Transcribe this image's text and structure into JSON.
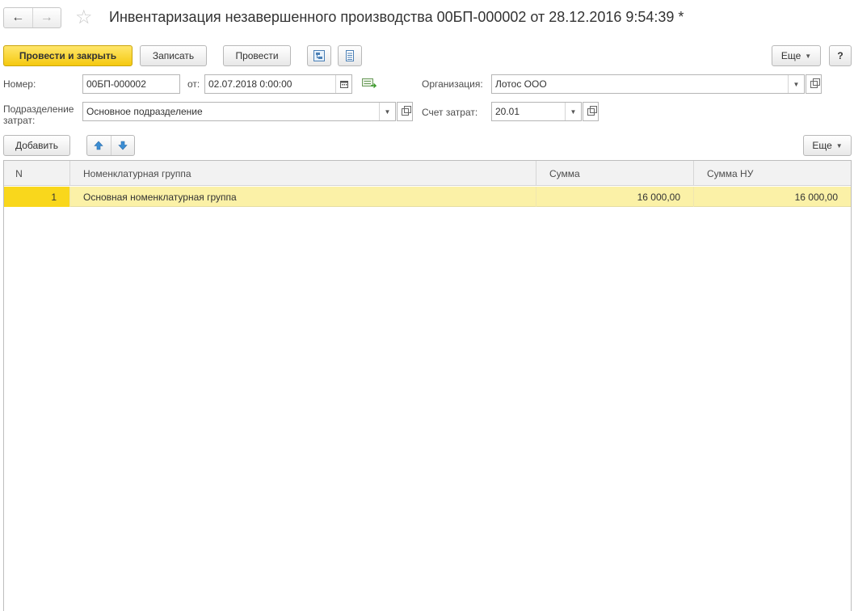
{
  "title": "Инвентаризация незавершенного производства 00БП-000002 от 28.12.2016 9:54:39 *",
  "nav": {
    "back_icon": "arrow-left",
    "forward_icon": "arrow-right",
    "favorite_icon": "star-outline"
  },
  "toolbar": {
    "post_and_close": "Провести и закрыть",
    "save": "Записать",
    "post": "Провести",
    "more": "Еще",
    "help": "?"
  },
  "form": {
    "number_label": "Номер:",
    "number_value": "00БП-000002",
    "date_label": "от:",
    "date_value": "02.07.2018  0:00:00",
    "org_label": "Организация:",
    "org_value": "Лотос ООО",
    "dept_label_1": "Подразделение",
    "dept_label_2": "затрат:",
    "dept_value": "Основное подразделение",
    "account_label": "Счет затрат:",
    "account_value": "20.01"
  },
  "table_toolbar": {
    "add": "Добавить",
    "more": "Еще"
  },
  "table": {
    "columns": [
      "N",
      "Номенклатурная группа",
      "Сумма",
      "Сумма НУ"
    ],
    "rows": [
      {
        "n": "1",
        "group": "Основная номенклатурная группа",
        "sum": "16 000,00",
        "sum_nu": "16 000,00"
      }
    ]
  },
  "colors": {
    "primary_button": "#f5c90f",
    "selected_row": "#fbf1a7",
    "selected_cell": "#f9d71c"
  }
}
